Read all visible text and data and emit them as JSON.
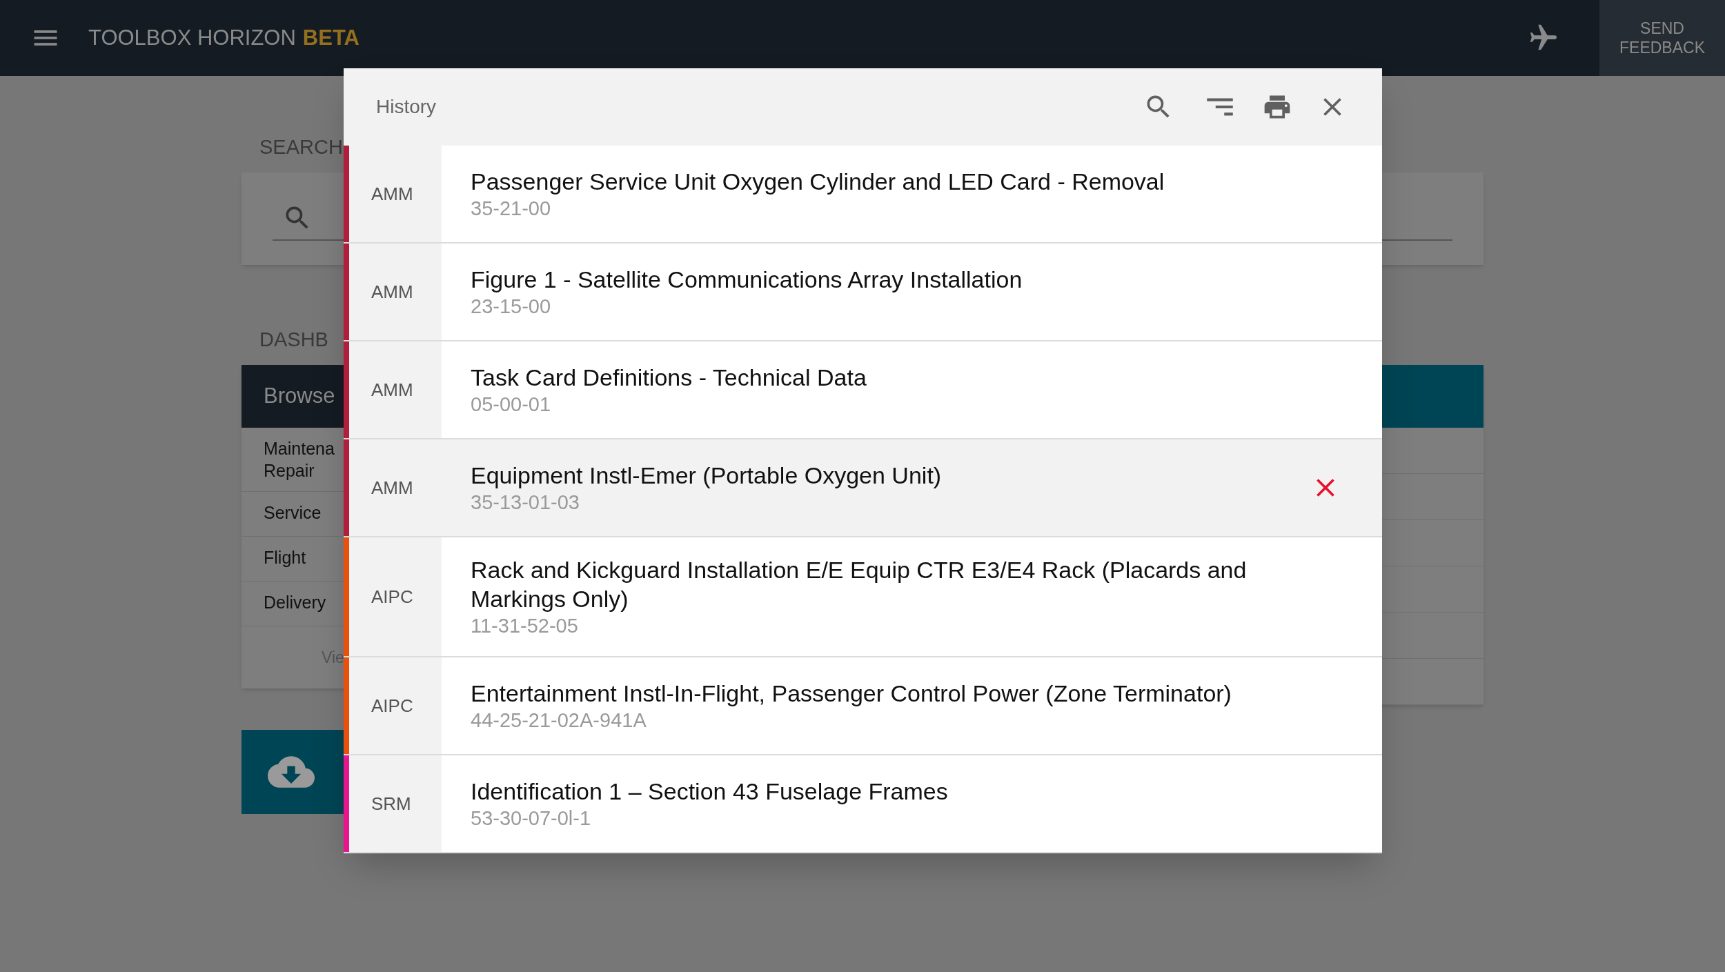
{
  "app_bar": {
    "title": "TOOLBOX HORIZON",
    "badge": "BETA",
    "feedback": "SEND FEEDBACK"
  },
  "background": {
    "search_heading": "SEARCH",
    "dashboard_heading": "DASHB",
    "browse_title": "Browse",
    "browse_items": [
      "Maintena\nRepair",
      "Service",
      "Flight",
      "Delivery"
    ],
    "view_link": "Vie"
  },
  "modal": {
    "title": "History",
    "rows": [
      {
        "category": "AMM",
        "color": "#b01e3c",
        "title": "Passenger Service Unit Oxygen Cylinder and LED Card - Removal",
        "code": "35-21-00",
        "hovered": false
      },
      {
        "category": "AMM",
        "color": "#b01e3c",
        "title": "Figure 1 - Satellite Communications Array Installation",
        "code": "23-15-00",
        "hovered": false
      },
      {
        "category": "AMM",
        "color": "#b01e3c",
        "title": "Task Card Definitions - Technical Data",
        "code": "05-00-01",
        "hovered": false
      },
      {
        "category": "AMM",
        "color": "#b01e3c",
        "title": "Equipment Instl-Emer (Portable Oxygen Unit)",
        "code": "35-13-01-03",
        "hovered": true
      },
      {
        "category": "AIPC",
        "color": "#e8500e",
        "title": "Rack and Kickguard Installation E/E Equip CTR E3/E4 Rack (Placards and Markings Only)",
        "code": "11-31-52-05",
        "hovered": false
      },
      {
        "category": "AIPC",
        "color": "#e8500e",
        "title": "Entertainment Instl-In-Flight, Passenger Control Power (Zone Terminator)",
        "code": "44-25-21-02A-941A",
        "hovered": false
      },
      {
        "category": "SRM",
        "color": "#e8168c",
        "title": "Identification 1 – Section 43 Fuselage Frames",
        "code": "53-30-07-0l-1",
        "hovered": false
      }
    ]
  }
}
